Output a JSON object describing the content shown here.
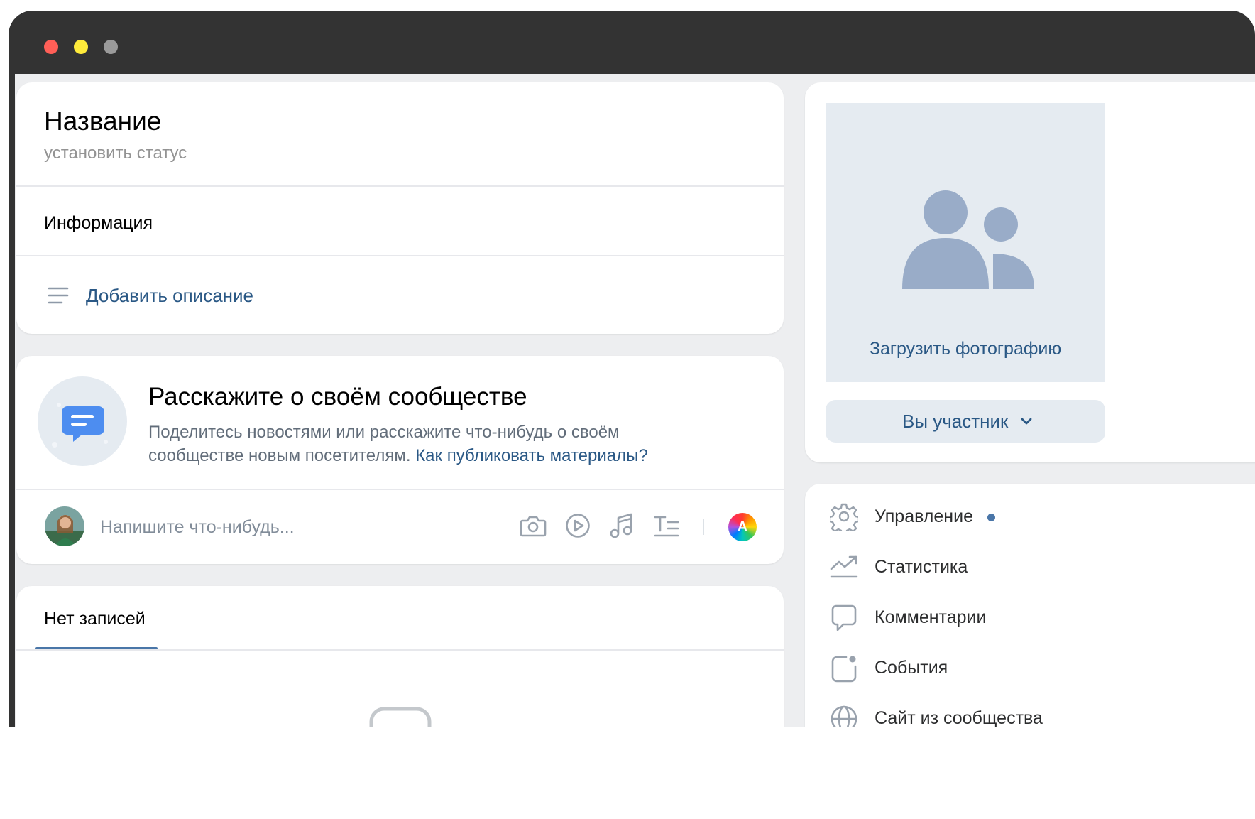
{
  "header": {
    "title": "Название",
    "status": "установить статус"
  },
  "info": {
    "heading": "Информация",
    "add_description": "Добавить описание"
  },
  "promo": {
    "title": "Расскажите о своём сообществе",
    "text_line1": "Поделитесь новостями или расскажите что-нибудь о своём",
    "text_line2": "сообществе новым посетителям.",
    "link": "Как публиковать материалы?"
  },
  "composer": {
    "placeholder": "Напишите что-нибудь...",
    "author_badge": "A"
  },
  "posts": {
    "tab_label": "Нет записей"
  },
  "sidebar": {
    "upload_photo": "Загрузить фотографию",
    "member_button": "Вы участник",
    "menu": [
      {
        "label": "Управление",
        "icon": "gear-icon"
      },
      {
        "label": "Статистика",
        "icon": "chart-icon"
      },
      {
        "label": "Комментарии",
        "icon": "comment-icon"
      },
      {
        "label": "События",
        "icon": "events-icon"
      },
      {
        "label": "Сайт из сообщества",
        "icon": "globe-icon"
      }
    ]
  },
  "colors": {
    "accent": "#2a5885",
    "tab_underline": "#4a76a8",
    "placeholder_bg": "#e5ebf1",
    "avatar_silhouette": "#99acc8",
    "notification_dot": "#4a76a8"
  }
}
